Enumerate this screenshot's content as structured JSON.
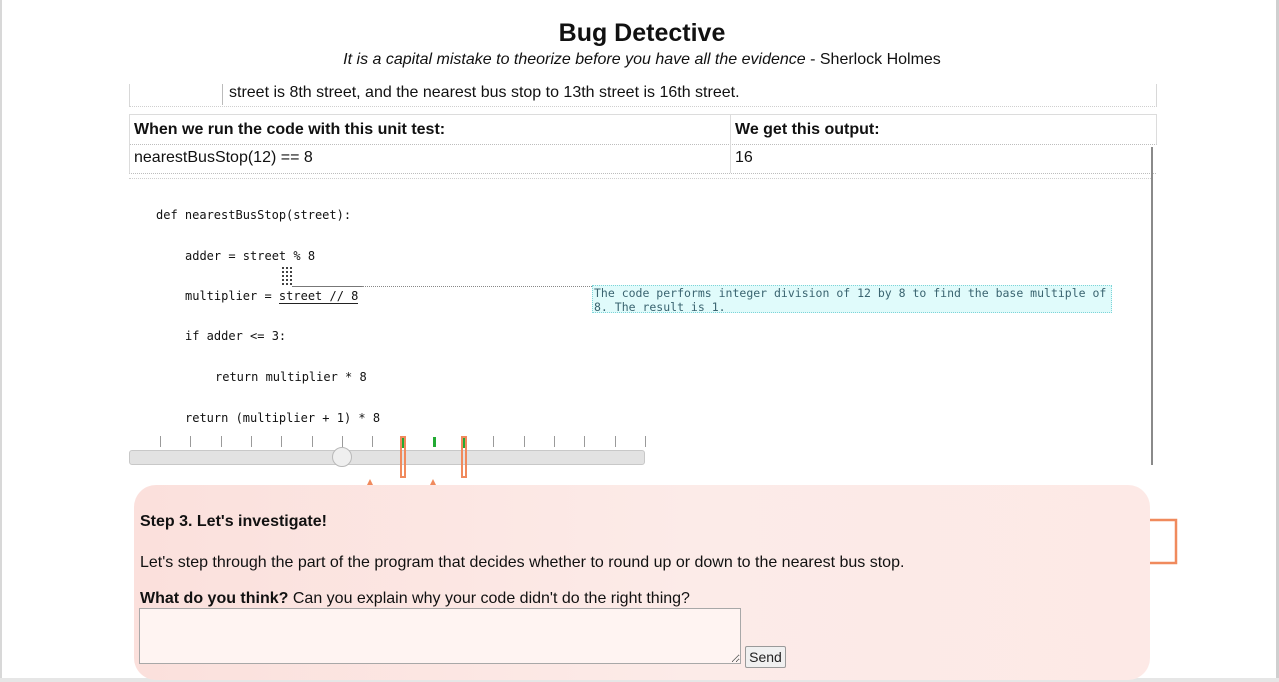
{
  "header": {
    "title": "Bug Detective",
    "quote": "It is a capital mistake to theorize before you have all the evidence",
    "quote_author": " - Sherlock Holmes"
  },
  "problem": {
    "text": "street is 8th street, and the nearest bus stop to 13th street is 16th street."
  },
  "test_table": {
    "col1_header": "When we run the code with this unit test:",
    "col2_header": "We get this output:",
    "test": "nearestBusStop(12) == 8",
    "output": "16"
  },
  "code": {
    "lines": [
      "def nearestBusStop(street):",
      "adder = street % 8",
      "multiplier = ",
      "if adder <= 3:",
      "return multiplier * 8",
      "return (multiplier + 1) * 8"
    ],
    "highlighted_token": "street // 8",
    "explanation": "The code performs integer division of 12 by 8 to find the base multiple of 8. The result is 1."
  },
  "timeline": {
    "tick_count": 17,
    "current_step": 6,
    "marked_steps": [
      8,
      10
    ],
    "colors": {
      "tick": "#9a9a9a",
      "executed": "#22aa33",
      "marker": "#f08a5d"
    }
  },
  "step": {
    "title": "Step 3. Let's investigate!",
    "description": "Let's step through the part of the program that decides whether to round up or down to the nearest bus stop.",
    "question_bold": "What do you think?",
    "question_rest": " Can you explain why your code didn't do the right thing?",
    "answer_value": "",
    "send_label": "Send"
  },
  "colors": {
    "panel_background": "#fbe0dc",
    "explanation_background": "#e0fbfb",
    "accent": "#f08a5d"
  }
}
